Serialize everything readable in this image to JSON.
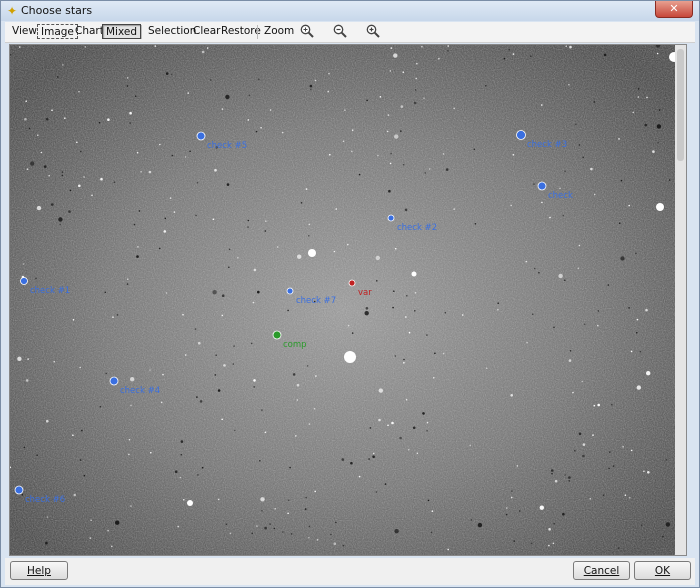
{
  "window": {
    "title": "Choose stars",
    "close_glyph": "✕"
  },
  "toolbar": {
    "view": "View",
    "image": "Image",
    "chart": "Chart",
    "mixed": "Mixed",
    "selection": "Selection",
    "clear": "Clear",
    "restore": "Restore",
    "zoom": "Zoom",
    "zoom_icons": [
      "zoom-fit-icon",
      "zoom-out-icon",
      "zoom-in-icon"
    ]
  },
  "stars": [
    {
      "label": "check #5",
      "color": "#3a6fe0",
      "type": "check"
    },
    {
      "label": "check #3",
      "color": "#3a6fe0",
      "type": "check"
    },
    {
      "label": "check",
      "color": "#3a6fe0",
      "type": "check"
    },
    {
      "label": "check #2",
      "color": "#3a6fe0",
      "type": "check"
    },
    {
      "label": "check #1",
      "color": "#3a6fe0",
      "type": "check"
    },
    {
      "label": "check #7",
      "color": "#3a6fe0",
      "type": "check"
    },
    {
      "label": "var",
      "color": "#c02222",
      "type": "var"
    },
    {
      "label": "comp",
      "color": "#2a9a2a",
      "type": "comp"
    },
    {
      "label": "check #4",
      "color": "#3a6fe0",
      "type": "check"
    },
    {
      "label": "check #6",
      "color": "#3a6fe0",
      "type": "check"
    }
  ],
  "footer": {
    "help": "Help",
    "cancel": "Cancel",
    "ok": "OK"
  }
}
